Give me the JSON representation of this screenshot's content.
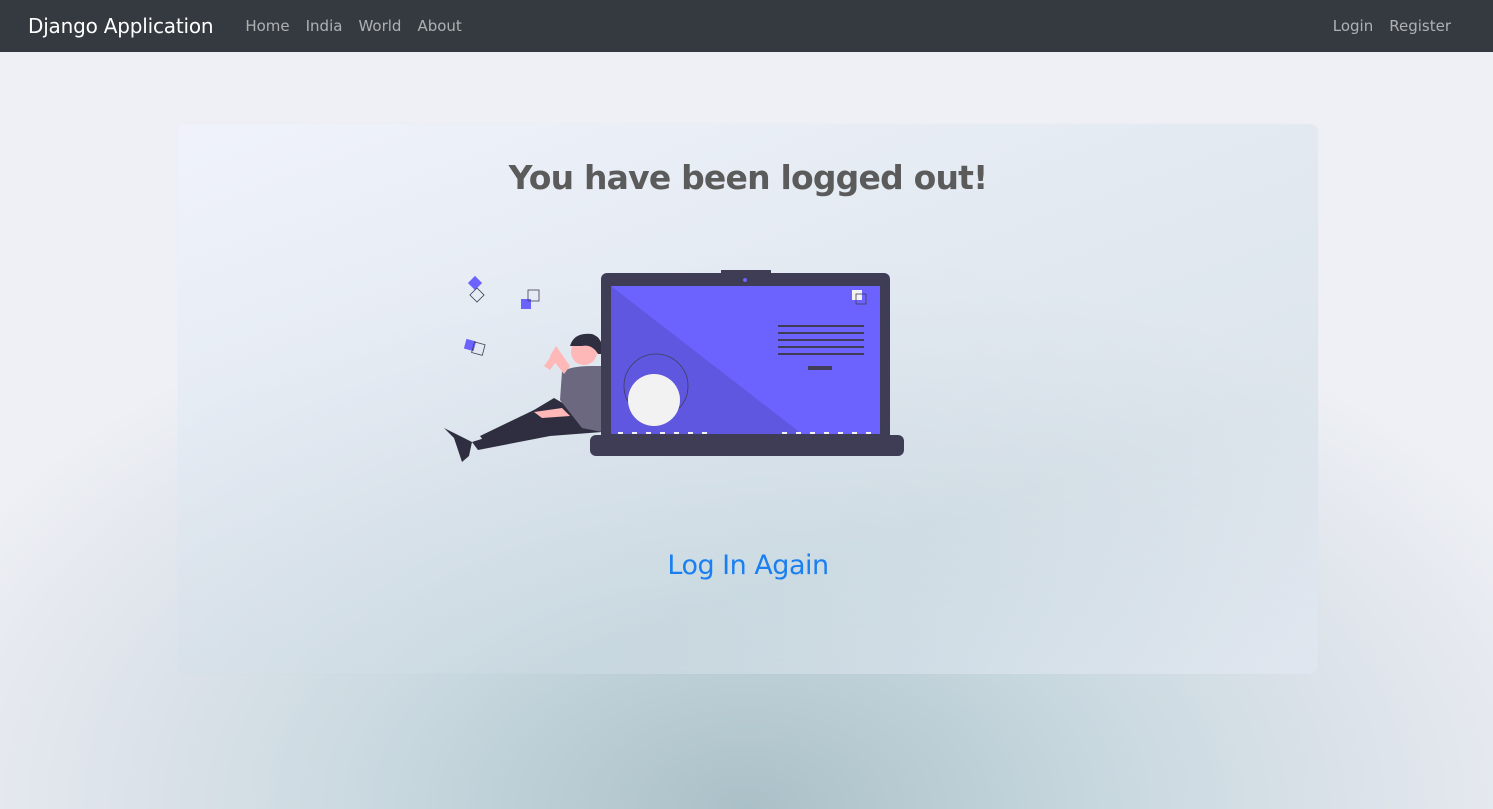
{
  "navbar": {
    "brand": "Django Application",
    "left_links": [
      "Home",
      "India",
      "World",
      "About"
    ],
    "right_links": [
      "Login",
      "Register"
    ]
  },
  "main": {
    "title": "You have been logged out!",
    "action_label": "Log In Again"
  },
  "colors": {
    "navbar_bg": "#343a40",
    "accent_purple": "#6c63ff",
    "laptop_dark": "#3f3d56",
    "link_blue": "#1a7ff0",
    "title_gray": "#5b5b5b"
  },
  "icons": [
    "logged-out-illustration"
  ]
}
